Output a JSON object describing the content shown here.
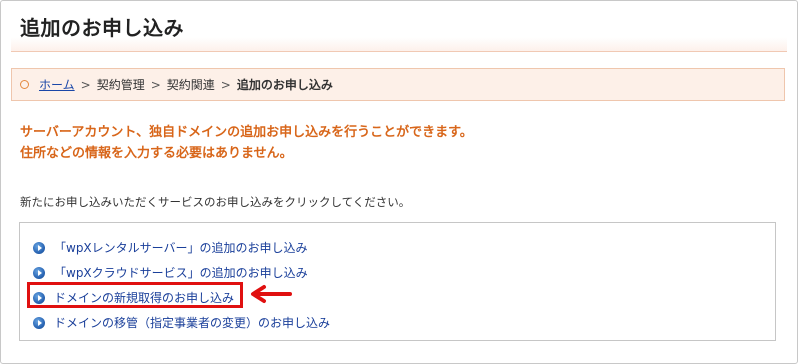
{
  "page": {
    "title": "追加のお申し込み"
  },
  "breadcrumb": {
    "home": "ホーム",
    "separator": ">",
    "items": [
      "契約管理",
      "契約関連"
    ],
    "current": "追加のお申し込み"
  },
  "notice": {
    "line1": "サーバーアカウント、独自ドメインの追加お申し込みを行うことができます。",
    "line2": "住所などの情報を入力する必要はありません。"
  },
  "instruction": "新たにお申し込みいただくサービスのお申し込みをクリックしてください。",
  "services": [
    {
      "label": "「wpXレンタルサーバー」の追加のお申し込み",
      "icon": "play-circle-icon"
    },
    {
      "label": "「wpXクラウドサービス」の追加のお申し込み",
      "icon": "play-circle-icon"
    },
    {
      "label": "ドメインの新規取得のお申し込み",
      "icon": "play-circle-icon"
    },
    {
      "label": "ドメインの移管（指定事業者の変更）のお申し込み",
      "icon": "play-circle-icon"
    }
  ],
  "colors": {
    "accent_orange": "#d8661a",
    "link_blue": "#1a3f9a",
    "highlight_red": "#e01010",
    "breadcrumb_bg": "#fdf0e8"
  }
}
